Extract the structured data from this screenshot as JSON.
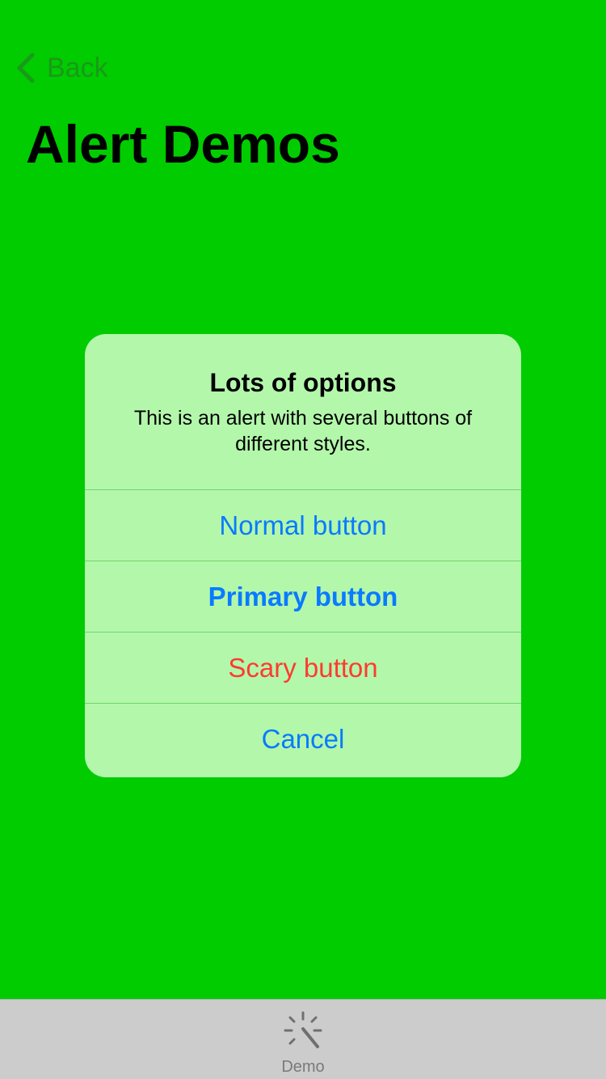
{
  "nav": {
    "back_label": "Back",
    "title": "Alert Demos"
  },
  "alert": {
    "title": "Lots of options",
    "message": "This is an alert with several buttons of different styles.",
    "buttons": [
      {
        "label": "Normal button",
        "style": "normal"
      },
      {
        "label": "Primary button",
        "style": "primary"
      },
      {
        "label": "Scary button",
        "style": "destructive"
      },
      {
        "label": "Cancel",
        "style": "cancel"
      }
    ]
  },
  "tabbar": {
    "items": [
      {
        "label": "Demo",
        "icon": "magic-wand-icon",
        "selected": true
      }
    ]
  },
  "colors": {
    "background": "#00cc00",
    "alert_background": "#b3f7ab",
    "link_blue": "#0a7aff",
    "destructive_red": "#ff3b30",
    "tabbar_background": "#cccccc"
  }
}
